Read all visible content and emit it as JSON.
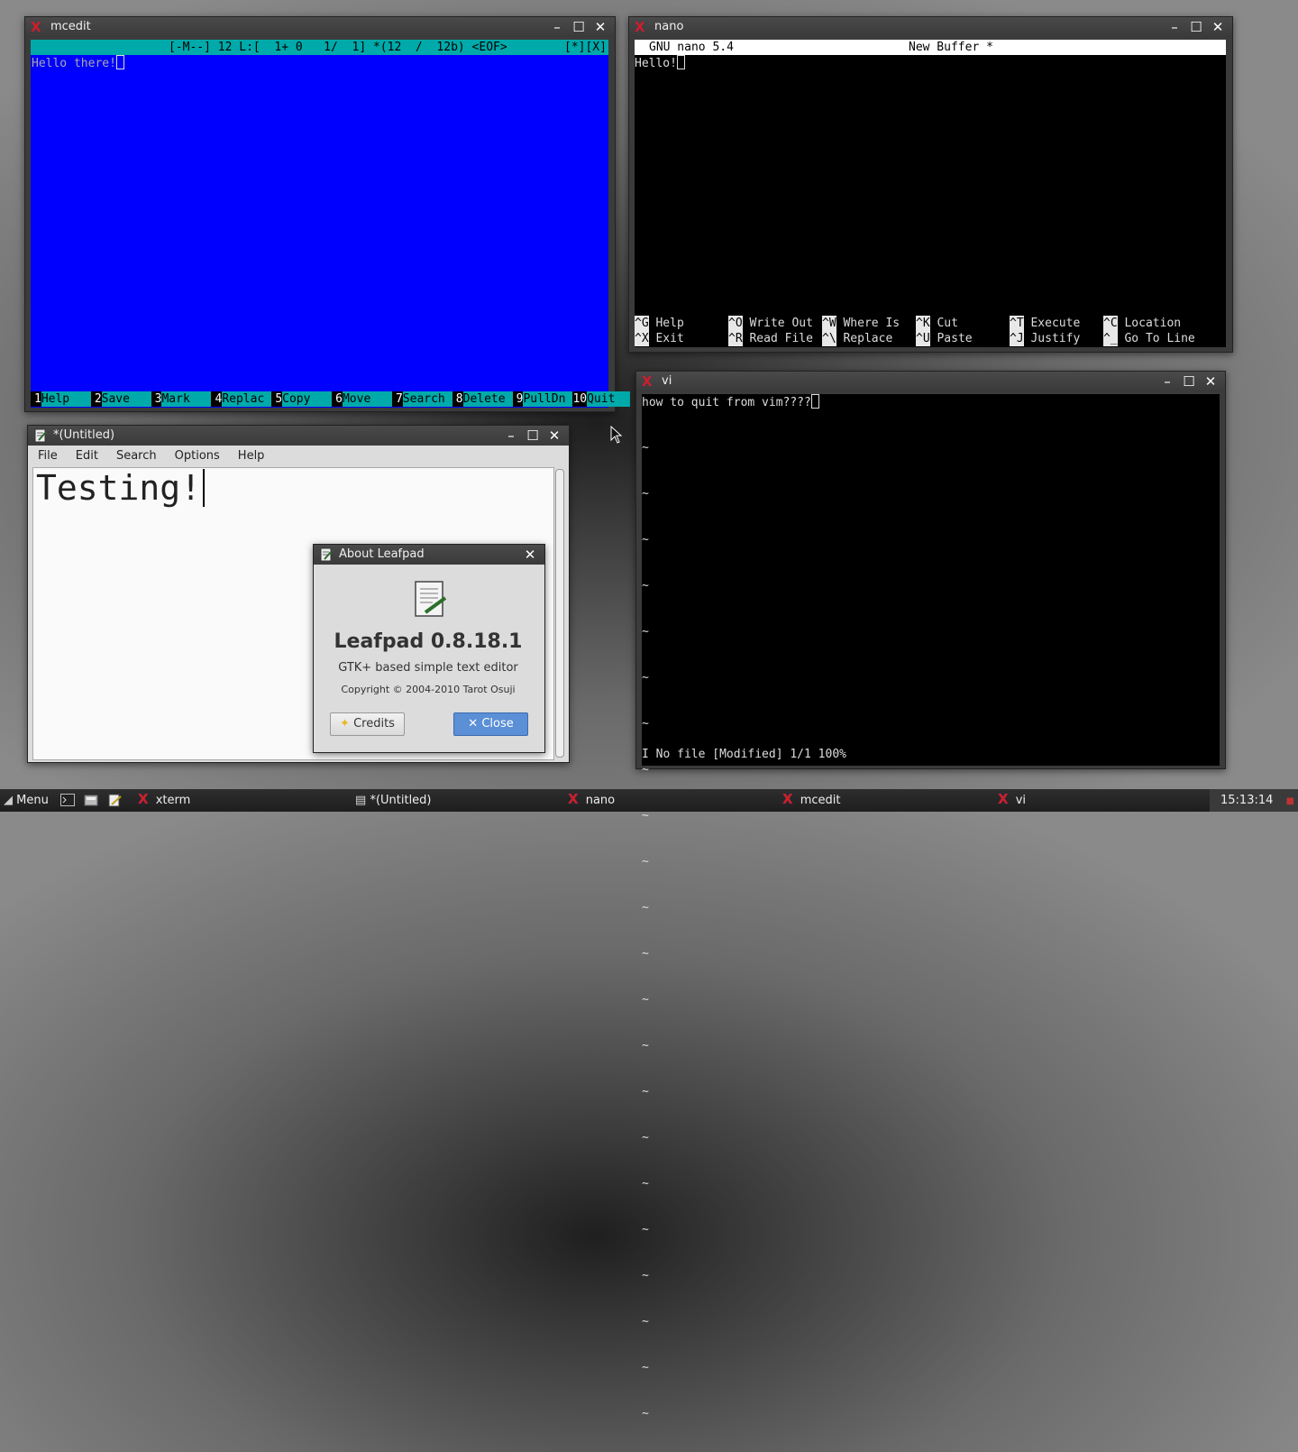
{
  "mcedit": {
    "title": "mcedit",
    "status": "[-M--] 12 L:[  1+ 0   1/  1] *(12  /  12b) <EOF>",
    "flags": "[*][X]",
    "text": "Hello there!",
    "fkeys": [
      {
        "n": "1",
        "label": "Help"
      },
      {
        "n": "2",
        "label": "Save"
      },
      {
        "n": "3",
        "label": "Mark"
      },
      {
        "n": "4",
        "label": "Replac"
      },
      {
        "n": "5",
        "label": "Copy"
      },
      {
        "n": "6",
        "label": "Move"
      },
      {
        "n": "7",
        "label": "Search"
      },
      {
        "n": "8",
        "label": "Delete"
      },
      {
        "n": "9",
        "label": "PullDn"
      },
      {
        "n": "10",
        "label": "Quit"
      }
    ]
  },
  "nano": {
    "title": "nano",
    "version": "GNU nano 5.4",
    "buffer": "New Buffer *",
    "text": "Hello!",
    "shortcuts": [
      {
        "key": "^G",
        "label": "Help"
      },
      {
        "key": "^O",
        "label": "Write Out"
      },
      {
        "key": "^W",
        "label": "Where Is"
      },
      {
        "key": "^K",
        "label": "Cut"
      },
      {
        "key": "^T",
        "label": "Execute"
      },
      {
        "key": "^C",
        "label": "Location"
      },
      {
        "key": "^X",
        "label": "Exit"
      },
      {
        "key": "^R",
        "label": "Read File"
      },
      {
        "key": "^\\",
        "label": "Replace"
      },
      {
        "key": "^U",
        "label": "Paste"
      },
      {
        "key": "^J",
        "label": "Justify"
      },
      {
        "key": "^_",
        "label": "Go To Line"
      }
    ]
  },
  "vi": {
    "title": "vi",
    "text": "how to quit from vim????",
    "tilde": "~",
    "status": "I No file [Modified] 1/1 100%"
  },
  "leafpad": {
    "title": "*(Untitled)",
    "menu": [
      "File",
      "Edit",
      "Search",
      "Options",
      "Help"
    ],
    "text": "Testing!"
  },
  "about": {
    "title": "About Leafpad",
    "name": "Leafpad 0.8.18.1",
    "description": "GTK+ based simple text editor",
    "copyright": "Copyright © 2004-2010 Tarot Osuji",
    "credits_label": "Credits",
    "close_label": "Close"
  },
  "window_buttons": {
    "minimize": "–",
    "maximize": "☐",
    "close": "✕"
  },
  "taskbar": {
    "menu_label": "Menu",
    "tasks": [
      "xterm",
      "*(Untitled)",
      "nano",
      "mcedit",
      "vi"
    ],
    "clock": "15:13:14"
  }
}
